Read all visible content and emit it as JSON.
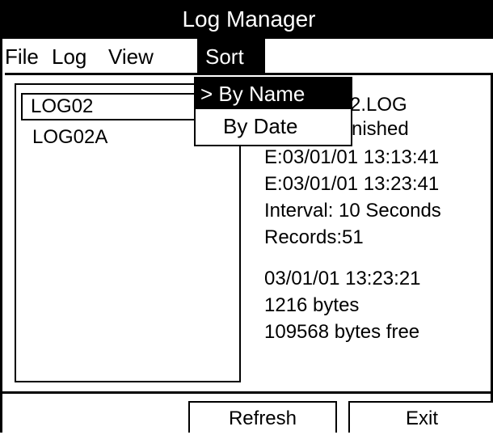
{
  "window": {
    "title": "Log Manager"
  },
  "menu": {
    "file": "File",
    "log": "Log",
    "view": "View",
    "sort": "Sort"
  },
  "sort_menu": {
    "options": [
      "> By Name",
      "By Date"
    ],
    "selected": "> By Name"
  },
  "log_list": {
    "items": [
      "LOG02",
      "LOG02A"
    ],
    "selected": "LOG02"
  },
  "details": {
    "name_partial": "2.LOG",
    "status_partial": "nished",
    "start_partial": "E:03/01/01 13:13:41",
    "end_partial": "E:03/01/01 13:23:41",
    "interval": "Interval: 10 Seconds",
    "records": "Records:51",
    "date_time": "03/01/01 13:23:21",
    "size": "1216 bytes",
    "free": "109568 bytes free"
  },
  "footer": {
    "refresh": "Refresh",
    "exit": "Exit"
  }
}
